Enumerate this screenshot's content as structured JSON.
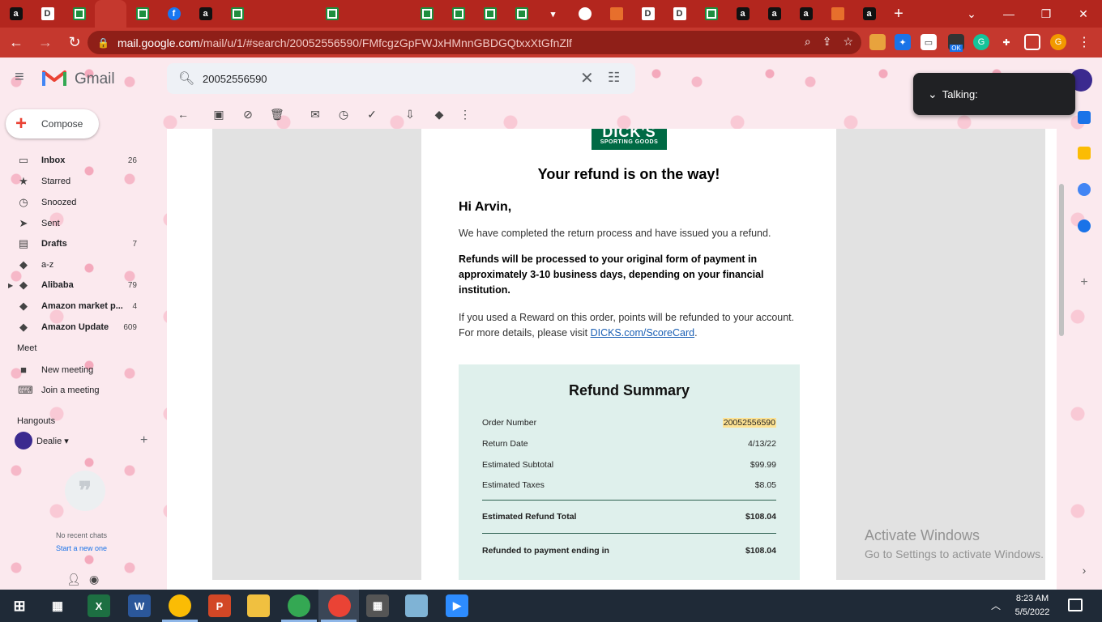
{
  "browser": {
    "url_domain": "mail.google.com",
    "url_path": "/mail/u/1/#search/20052556590/FMfcgzGpFWJxHMnnGBDGQtxxXtGfnZlf",
    "extension_badge": "OK",
    "profile_initial": "G"
  },
  "gmail": {
    "app_name": "Gmail",
    "search_query": "20052556590",
    "talking_label": "Talking:",
    "compose_label": "Compose",
    "nav": [
      {
        "label": "Inbox",
        "count": "26"
      },
      {
        "label": "Starred",
        "count": ""
      },
      {
        "label": "Snoozed",
        "count": ""
      },
      {
        "label": "Sent",
        "count": ""
      },
      {
        "label": "Drafts",
        "count": "7"
      },
      {
        "label": "a-z",
        "count": ""
      },
      {
        "label": "Alibaba",
        "count": "79"
      },
      {
        "label": "Amazon market p...",
        "count": "4"
      },
      {
        "label": "Amazon Update",
        "count": "609"
      }
    ],
    "meet_heading": "Meet",
    "meet_items": [
      "New meeting",
      "Join a meeting"
    ],
    "hangouts_heading": "Hangouts",
    "hangout_user": "Dealie",
    "no_chats": "No recent chats",
    "start_chat": "Start a new one"
  },
  "email": {
    "logo_line1": "DICK'S",
    "logo_line2": "SPORTING GOODS",
    "title": "Your refund is on the way!",
    "greeting": "Hi Arvin,",
    "para1": "We have completed the return process and have issued you a refund.",
    "para2": "Refunds will be processed to your original form of payment in approximately 3-10 business days, depending on your financial institution.",
    "para3_text": "If you used a Reward on this order, points will be refunded to your account. For more details, please visit ",
    "para3_link": "DICKS.com/ScoreCard",
    "para3_end": ".",
    "summary_title": "Refund Summary",
    "summary": [
      {
        "key": "Order Number",
        "value": "20052556590"
      },
      {
        "key": "Return Date",
        "value": "4/13/22"
      },
      {
        "key": "Estimated Subtotal",
        "value": "$99.99"
      },
      {
        "key": "Estimated Taxes",
        "value": "$8.05"
      },
      {
        "key": "Estimated Refund Total",
        "value": "$108.04"
      },
      {
        "key": "Refunded to payment ending in",
        "value": "$108.04"
      }
    ]
  },
  "watermark": {
    "line1": "Activate Windows",
    "line2": "Go to Settings to activate Windows."
  },
  "taskbar": {
    "time": "8:23 AM",
    "date": "5/5/2022"
  }
}
